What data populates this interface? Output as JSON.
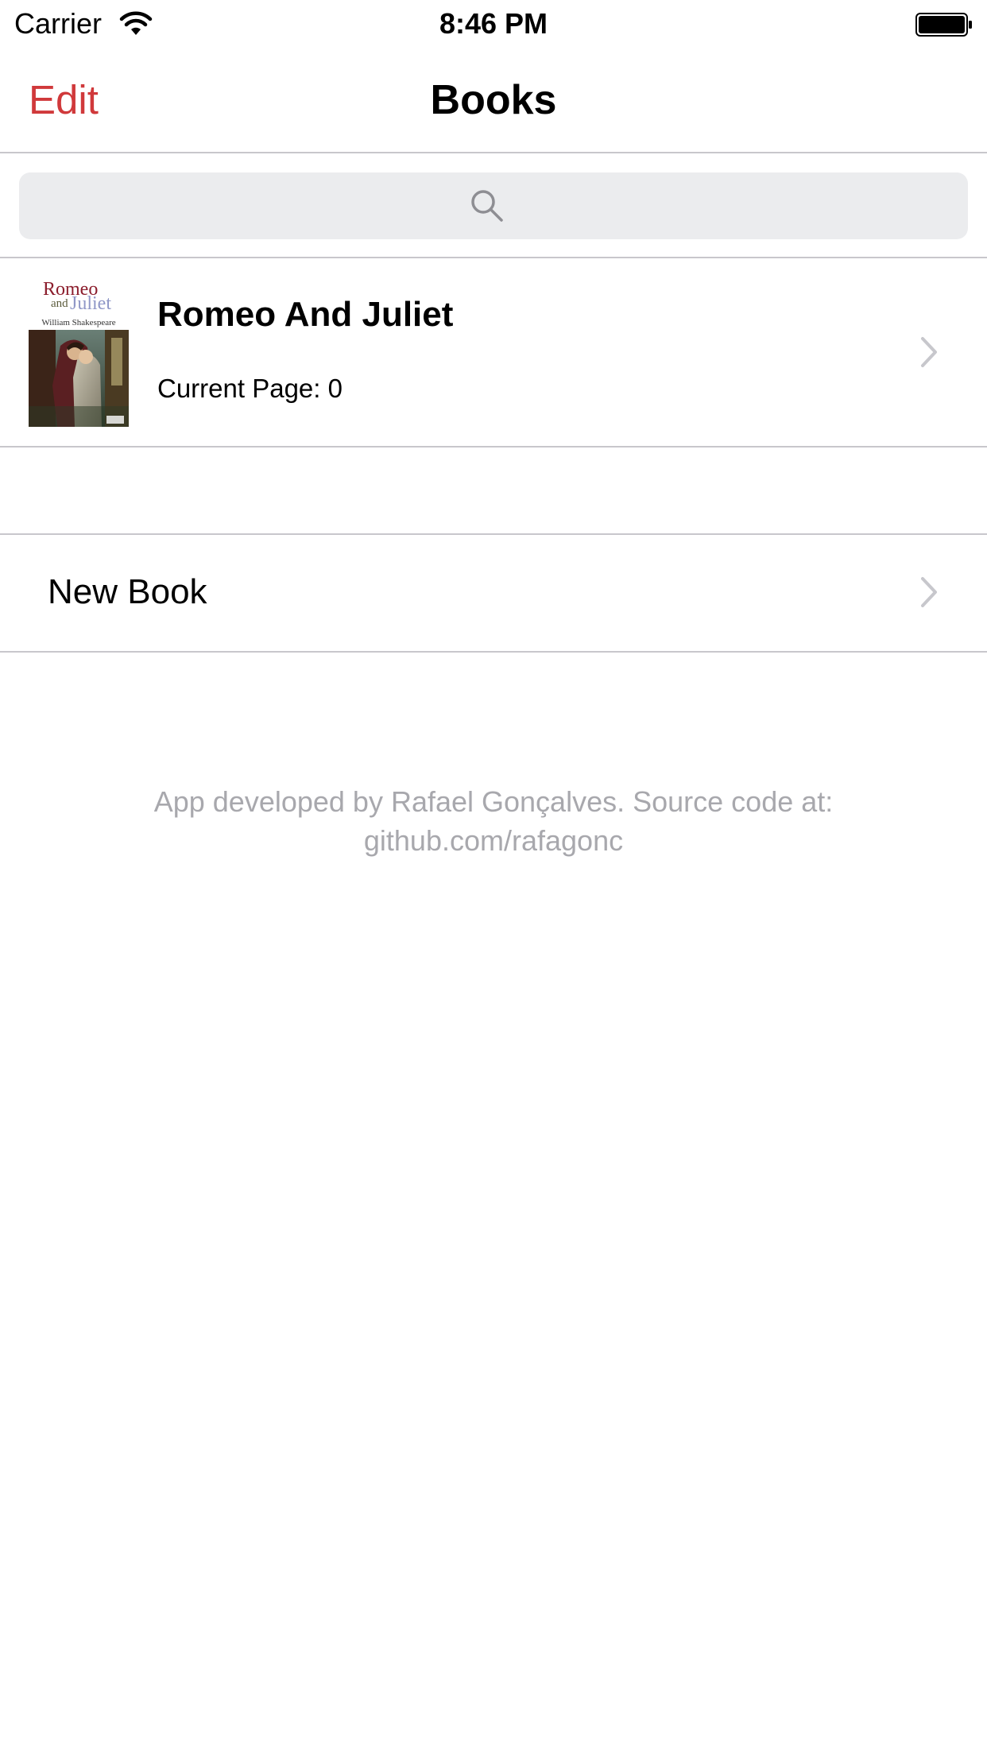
{
  "status_bar": {
    "carrier": "Carrier",
    "time": "8:46 PM"
  },
  "nav": {
    "edit_label": "Edit",
    "title": "Books"
  },
  "search": {
    "placeholder": ""
  },
  "books": [
    {
      "title": "Romeo And Juliet",
      "current_page": "Current Page: 0",
      "cover": {
        "title_line1": "Romeo",
        "title_and": "and",
        "title_line2": "Juliet",
        "author": "William Shakespeare"
      }
    }
  ],
  "new_book": {
    "label": "New Book"
  },
  "footer": {
    "text": "App developed by Rafael Gonçalves. Source code at: github.com/rafagonc"
  },
  "colors": {
    "accent": "#d0393b",
    "separator": "#c8c7cc",
    "search_bg": "#ebecee",
    "footer_text": "#a8a8ad",
    "chevron": "#c7c7cc"
  },
  "icons": {
    "wifi": "wifi-icon",
    "battery": "battery-icon",
    "search": "search-icon",
    "chevron": "chevron-right-icon"
  }
}
